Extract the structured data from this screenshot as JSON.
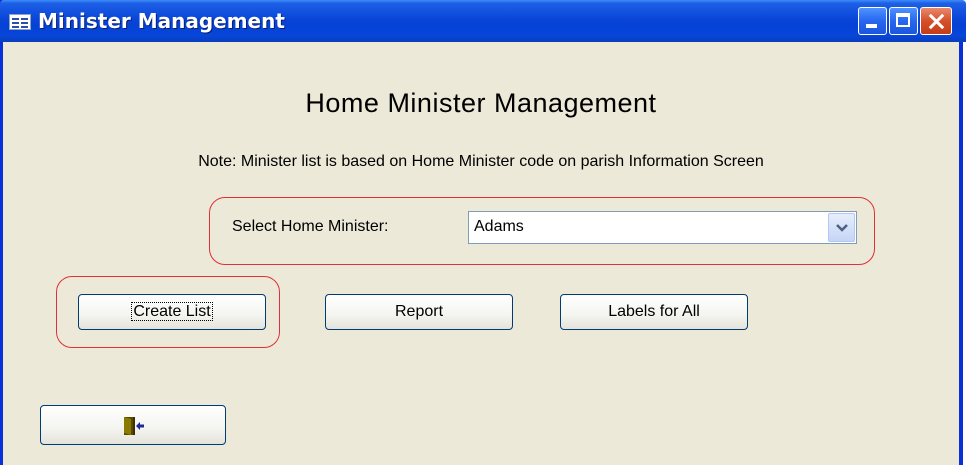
{
  "window": {
    "title": "Minister Management"
  },
  "form": {
    "heading": "Home Minister Management",
    "note": "Note: Minister list is based on Home Minister code on parish Information Screen",
    "select_label": "Select Home Minister:",
    "select_value": "Adams"
  },
  "buttons": {
    "create_list": "Create List",
    "report": "Report",
    "labels_for_all": "Labels for All",
    "exit_icon": "exit-door-icon"
  },
  "colors": {
    "titlebar": "#0a46d8",
    "background": "#ece9d8",
    "highlight": "#e0303a"
  }
}
